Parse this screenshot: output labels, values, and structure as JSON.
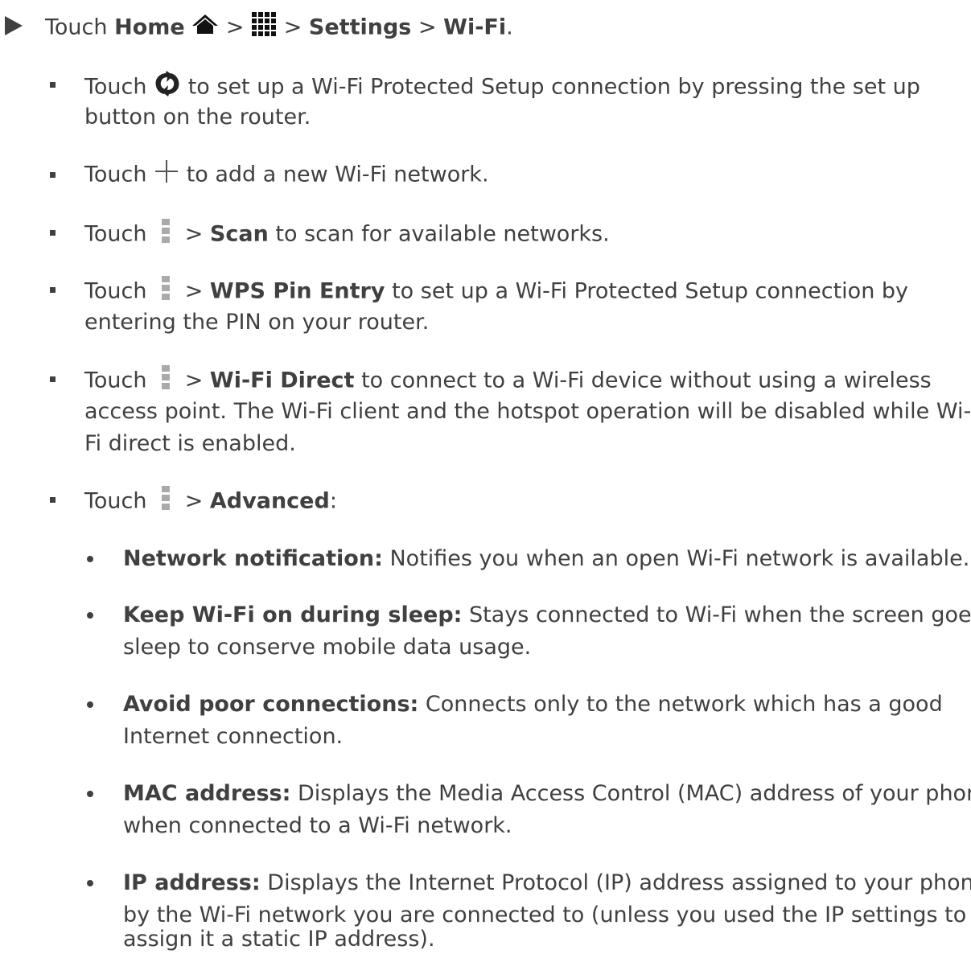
{
  "step": {
    "touch": "Touch",
    "home": "Home",
    "sep": ">",
    "settings": "Settings",
    "wifi": "Wi-Fi",
    "period": "."
  },
  "bullets": {
    "wps_touch": "Touch",
    "wps_line1": "to set up a Wi-Fi Protected Setup connection by pressing the set up",
    "wps_line2": "button on the router.",
    "add_touch": "Touch",
    "add_text": "to add a new Wi-Fi network.",
    "scan_touch": "Touch",
    "scan_sep": ">",
    "scan_bold": "Scan",
    "scan_text": "to scan for available networks.",
    "pin_touch": "Touch",
    "pin_sep": ">",
    "pin_bold": "WPS Pin Entry",
    "pin_text": "to set up a Wi-Fi Protected Setup connection by",
    "pin_line2": "entering the PIN on your router.",
    "direct_touch": "Touch",
    "direct_sep": ">",
    "direct_bold": "Wi-Fi Direct",
    "direct_text": "to connect to a Wi-Fi device without using a wireless",
    "direct_line2": "access point. The Wi-Fi client and the hotspot operation will be disabled while Wi-",
    "direct_line3": "Fi direct is enabled.",
    "adv_touch": "Touch",
    "adv_sep": ">",
    "adv_bold": "Advanced",
    "adv_colon": ":"
  },
  "advanced": {
    "net_bold": "Network notification:",
    "net_text": "Notifies you when an open Wi-Fi network is available.",
    "keep_bold": "Keep Wi-Fi on during sleep:",
    "keep_text": "Stays connected to Wi-Fi when the screen goes to",
    "keep_line2": "sleep to conserve mobile data usage.",
    "avoid_bold": "Avoid poor connections:",
    "avoid_text": "Connects only to the network which has a good",
    "avoid_line2": "Internet connection.",
    "mac_bold": "MAC address:",
    "mac_text": "Displays the Media Access Control (MAC) address of your phone",
    "mac_line2": "when connected to a Wi-Fi network.",
    "ip_bold": "IP address:",
    "ip_text": "Displays the Internet Protocol (IP) address assigned to your phone",
    "ip_line2": "by the Wi-Fi network you are connected to (unless you used the IP settings to",
    "ip_line3": "assign it a static IP address)."
  },
  "icons": {
    "home": "home-icon",
    "apps": "apps-grid-icon",
    "wps": "wps-icon",
    "add": "plus-icon",
    "menu": "menu-dots-icon"
  },
  "colors": {
    "text": "#404040",
    "icon_dark": "#111111",
    "icon_gray": "#a0a0a0"
  }
}
